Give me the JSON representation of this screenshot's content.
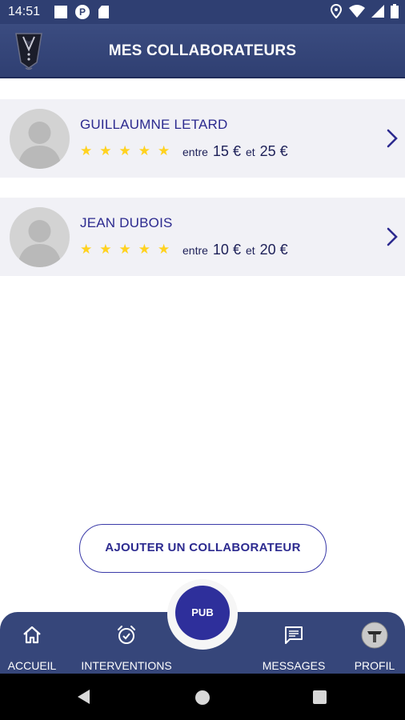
{
  "status_bar": {
    "time": "14:51",
    "icons": [
      "notification-square-icon",
      "p-notification-icon",
      "sim-card-icon",
      "location-icon",
      "wifi-icon",
      "signal-icon",
      "battery-icon"
    ]
  },
  "header": {
    "title": "MES COLLABORATEURS",
    "logo": "tuxedo-logo-icon"
  },
  "collaborators": [
    {
      "name": "GUILLAUMNE LETARD",
      "stars": 5,
      "between_label": "entre",
      "min_price": "15 €",
      "and_label": "et",
      "max_price": "25 €"
    },
    {
      "name": "JEAN DUBOIS",
      "stars": 5,
      "between_label": "entre",
      "min_price": "10 €",
      "and_label": "et",
      "max_price": "20 €"
    }
  ],
  "add_button": {
    "label": "AJOUTER UN COLLABORATEUR"
  },
  "bottom_nav": {
    "pub_label": "PUB",
    "items": [
      {
        "label": "ACCUEIL",
        "icon": "home-icon"
      },
      {
        "label": "INTERVENTIONS",
        "icon": "alarm-clock-icon"
      },
      {
        "label": "MESSAGES",
        "icon": "message-icon"
      },
      {
        "label": "PROFIL",
        "icon": "profile-avatar-icon"
      }
    ]
  },
  "colors": {
    "header_bg": "#2f3f72",
    "accent": "#2c2a8f",
    "star": "#ffd21f",
    "card_bg": "#f1f1f6"
  }
}
